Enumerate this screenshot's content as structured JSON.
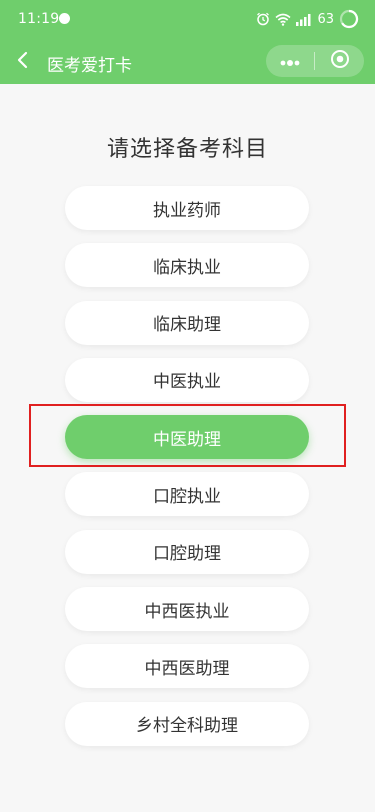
{
  "status_bar": {
    "time": "11:19",
    "battery": "63"
  },
  "nav": {
    "title": "医考爱打卡",
    "back_icon": "chevron-left-icon",
    "more_icon": "more-dots-icon",
    "close_icon": "target-circle-icon"
  },
  "heading": "请选择备考科目",
  "subjects": [
    {
      "label": "执业药师"
    },
    {
      "label": "临床执业"
    },
    {
      "label": "临床助理"
    },
    {
      "label": "中医执业"
    },
    {
      "label": "中医助理"
    },
    {
      "label": "口腔执业"
    },
    {
      "label": "口腔助理"
    },
    {
      "label": "中西医执业"
    },
    {
      "label": "中西医助理"
    },
    {
      "label": "乡村全科助理"
    }
  ],
  "selected_subject": "中医助理",
  "colors": {
    "accent": "#6fce6c",
    "highlight": "#e02020",
    "text": "#333333",
    "background": "#f7f7f7"
  }
}
